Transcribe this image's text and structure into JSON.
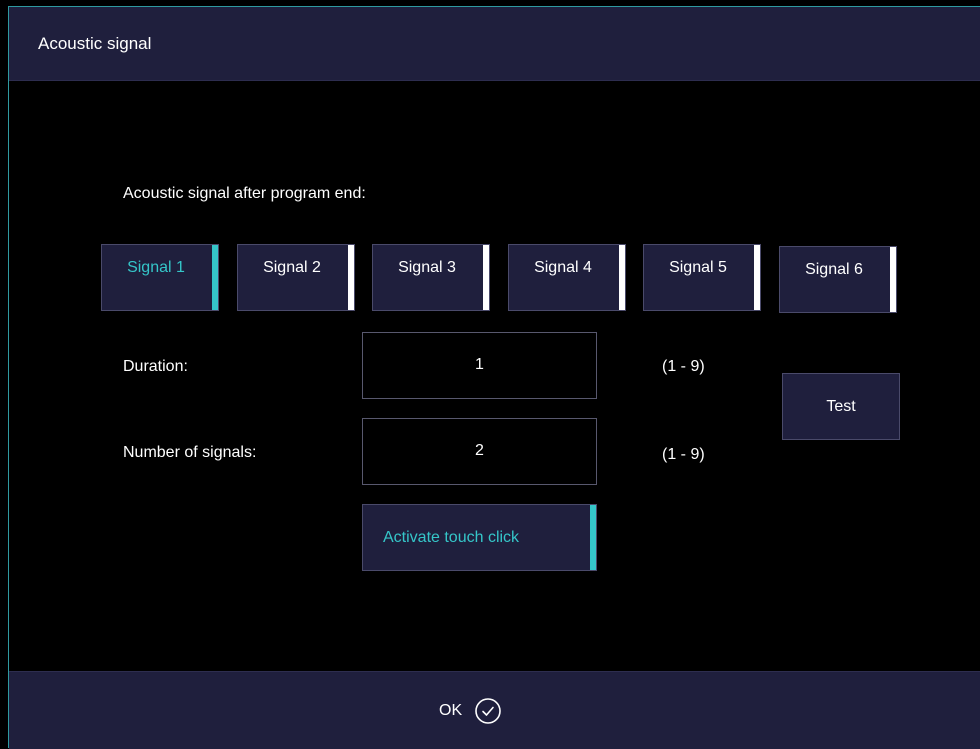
{
  "dialog": {
    "title": "Acoustic signal"
  },
  "main": {
    "signal_heading": "Acoustic signal after program end:",
    "signals": [
      "Signal 1",
      "Signal 2",
      "Signal 3",
      "Signal 4",
      "Signal 5",
      "Signal 6"
    ],
    "selected_signal": "Signal 1",
    "duration": {
      "label": "Duration:",
      "value": "1",
      "range": "(1 - 9)"
    },
    "number_of_signals": {
      "label": "Number of signals:",
      "value": "2",
      "range": "(1 - 9)"
    },
    "test_label": "Test",
    "touch_click_label": "Activate touch click"
  },
  "footer": {
    "ok_label": "OK",
    "ok_icon": "check-circle-icon"
  },
  "colors": {
    "accent": "#35c6c9",
    "panel": "#1f1f3d",
    "background": "#000000"
  }
}
